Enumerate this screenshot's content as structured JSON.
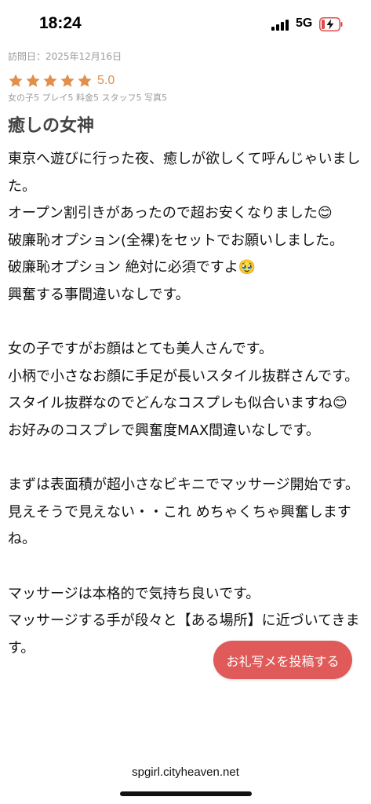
{
  "status_bar": {
    "time": "18:24",
    "network": "5G"
  },
  "review": {
    "visit_date": "訪問日：2025年12月16日",
    "stars": 5,
    "rating": "5.0",
    "category_scores": "女の子5 プレイ5 料金5 スタッフ5 写真5",
    "title": "癒しの女神",
    "body": "東京へ遊びに行った夜、癒しが欲しくて呼んじゃいました。\nオープン割引きがあったので超お安くなりました😊\n破廉恥オプション(全裸)をセットでお願いしました。\n破廉恥オプション 絶対に必須ですよ🥹\n興奮する事間違いなしです。\n\n女の子ですがお顔はとても美人さんです。\n小柄で小さなお顔に手足が長いスタイル抜群さんです。\nスタイル抜群なのでどんなコスプレも似合いますね😊\nお好みのコスプレで興奮度MAX間違いなしです。\n\nまずは表面積が超小さなビキニでマッサージ開始です。\n見えそうで見えない・・これ めちゃくちゃ興奮しますね。\n\nマッサージは本格的で気持ち良いです。\nマッサージする手が段々と【ある場所】に近づいてきます。"
  },
  "post_button": {
    "label": "お礼写メを投稿する"
  },
  "browser": {
    "url": "spgirl.cityheaven.net"
  },
  "colors": {
    "star": "#e08f4c",
    "button": "#e05a5a",
    "meta_text": "#9a9a9a",
    "title_text": "#444444"
  }
}
